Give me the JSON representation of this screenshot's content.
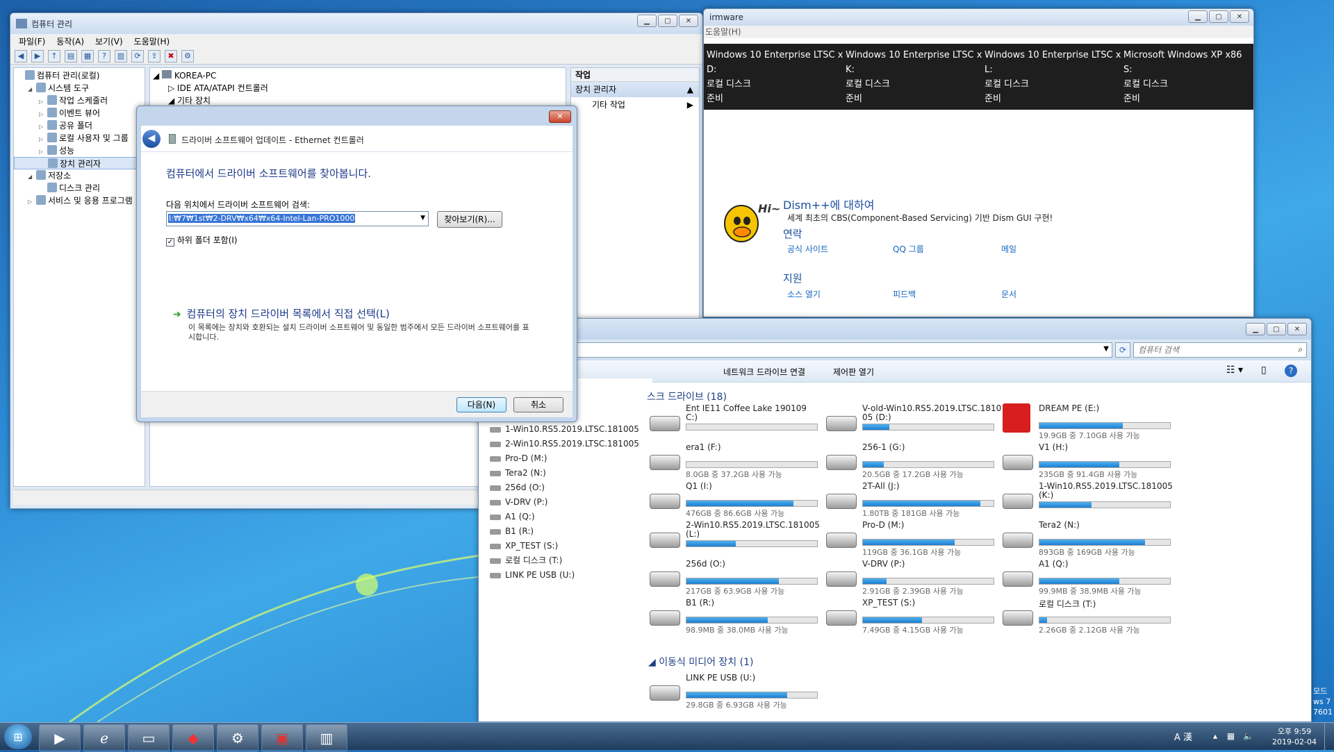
{
  "cm": {
    "title": "컴퓨터 관리",
    "menu": [
      "파일(F)",
      "동작(A)",
      "보기(V)",
      "도움말(H)"
    ],
    "tree": [
      {
        "label": "컴퓨터 관리(로컬)",
        "indent": 0,
        "exp": ""
      },
      {
        "label": "시스템 도구",
        "indent": 1,
        "exp": "◢"
      },
      {
        "label": "작업 스케줄러",
        "indent": 2,
        "exp": "▷"
      },
      {
        "label": "이벤트 뷰어",
        "indent": 2,
        "exp": "▷"
      },
      {
        "label": "공유 폴더",
        "indent": 2,
        "exp": "▷"
      },
      {
        "label": "로컬 사용자 및 그룹",
        "indent": 2,
        "exp": "▷"
      },
      {
        "label": "성능",
        "indent": 2,
        "exp": "▷"
      },
      {
        "label": "장치 관리자",
        "indent": 2,
        "exp": "",
        "sel": true
      },
      {
        "label": "저장소",
        "indent": 1,
        "exp": "◢"
      },
      {
        "label": "디스크 관리",
        "indent": 2,
        "exp": ""
      },
      {
        "label": "서비스 및 응용 프로그램",
        "indent": 1,
        "exp": "▷"
      }
    ],
    "dev": [
      "KOREA-PC",
      "IDE ATA/ATAPI 컨트롤러",
      "기타 장치"
    ],
    "actions_header": "작업",
    "actions_section": "장치 관리자",
    "actions_more": "기타 작업"
  },
  "dlg": {
    "title": "드라이버 소프트웨어 업데이트 - Ethernet 컨트롤러",
    "heading": "컴퓨터에서 드라이버 소프트웨어를 찾아봅니다.",
    "search_label": "다음 위치에서 드라이버 소프트웨어 검색:",
    "path": "I:₩7₩1st₩2-DRV₩x64₩x64-Intel-Lan-PRO1000",
    "browse": "찾아보기(R)...",
    "include_sub": "하위 폴더 포함(I)",
    "choose_title": "컴퓨터의 장치 드라이버 목록에서 직접 선택(L)",
    "choose_desc": "이 목록에는 장치와 호환되는 설치 드라이버 소프트웨어 및 동일한 범주에서 모든 드라이버 소프트웨어를 표시합니다.",
    "next": "다음(N)",
    "cancel": "취소"
  },
  "dism": {
    "title_frag": "irmware",
    "menu_frag": "도움말(H)",
    "cols": [
      {
        "name": "Windows 10 Enterprise LTSC xt",
        "drive": "D:",
        "type": "로컬 디스크",
        "status": "준비"
      },
      {
        "name": "Windows 10 Enterprise LTSC xt",
        "drive": "K:",
        "type": "로컬 디스크",
        "status": "준비"
      },
      {
        "name": "Windows 10 Enterprise LTSC xt",
        "drive": "L:",
        "type": "로컬 디스크",
        "status": "준비"
      },
      {
        "name": "Microsoft Windows XP x86",
        "drive": "S:",
        "type": "로컬 디스크",
        "status": "준비"
      }
    ],
    "about_title": "Dism++에 대하여",
    "about_desc": "세계 최초의 CBS(Component-Based Servicing) 기반 Dism GUI 구현!",
    "contact": "연락",
    "c1": "공식 사이트",
    "c2": "QQ 그룹",
    "c3": "메일",
    "support": "지원",
    "s1": "소스 열기",
    "s2": "피드백",
    "s3": "문서",
    "hi": "Hi~"
  },
  "exp": {
    "search_placeholder": "컴퓨터 검색",
    "cmd1": "네트워크 드라이브 연결",
    "cmd2": "제어판 열기",
    "group1": "스크 드라이브 (18)",
    "group2": "이동식 미디어 장치 (1)",
    "drives": [
      {
        "name": "Ent IE11 Coffee Lake 190109",
        "name2": "C:)",
        "info": "",
        "frac": 0
      },
      {
        "name": "V-old-Win10.RS5.2019.LTSC.1810",
        "name2": "05 (D:)",
        "info": "",
        "frac": 0.2
      },
      {
        "name": "DREAM PE (E:)",
        "info": "19.9GB 중 7.10GB 사용 가능",
        "frac": 0.64
      },
      {
        "name": "era1 (F:)",
        "info": "8.0GB 중 37.2GB 사용 가능",
        "frac": 0
      },
      {
        "name": "256-1 (G:)",
        "info": "20.5GB 중 17.2GB 사용 가능",
        "frac": 0.16
      },
      {
        "name": "V1 (H:)",
        "info": "235GB 중 91.4GB 사용 가능",
        "frac": 0.61
      },
      {
        "name": "Q1 (I:)",
        "info": "476GB 중 86.6GB 사용 가능",
        "frac": 0.82
      },
      {
        "name": "2T-All (J:)",
        "info": "1.80TB 중 181GB 사용 가능",
        "frac": 0.9
      },
      {
        "name": "1-Win10.RS5.2019.LTSC.181005",
        "name2": "(K:)",
        "info": "",
        "frac": 0.4
      },
      {
        "name": "2-Win10.RS5.2019.LTSC.181005",
        "name2": "(L:)",
        "info": "",
        "frac": 0.38
      },
      {
        "name": "Pro-D (M:)",
        "info": "119GB 중 36.1GB 사용 가능",
        "frac": 0.7
      },
      {
        "name": "Tera2 (N:)",
        "info": "893GB 중 169GB 사용 가능",
        "frac": 0.81
      },
      {
        "name": "256d (O:)",
        "info": "217GB 중 63.9GB 사용 가능",
        "frac": 0.71
      },
      {
        "name": "V-DRV (P:)",
        "info": "2.91GB 중 2.39GB 사용 가능",
        "frac": 0.18
      },
      {
        "name": "A1 (Q:)",
        "info": "99.9MB 중 38.9MB 사용 가능",
        "frac": 0.61
      },
      {
        "name": "B1 (R:)",
        "info": "98.9MB 중 38.0MB 사용 가능",
        "frac": 0.62
      },
      {
        "name": "XP_TEST (S:)",
        "info": "7.49GB 중 4.15GB 사용 가능",
        "frac": 0.45
      },
      {
        "name": "로컬 디스크 (T:)",
        "info": "2.26GB 중 2.12GB 사용 가능",
        "frac": 0.06
      },
      {
        "name": "LINK PE USB (U:)",
        "info": "29.8GB 중 6.93GB 사용 가능",
        "frac": 0.77
      }
    ],
    "nav": [
      "V1 (H:)",
      "Q1 (I:)",
      "2T-All (J:)",
      "1-Win10.RS5.2019.LTSC.181005",
      "2-Win10.RS5.2019.LTSC.181005",
      "Pro-D (M:)",
      "Tera2 (N:)",
      "256d (O:)",
      "V-DRV (P:)",
      "A1 (Q:)",
      "B1 (R:)",
      "XP_TEST (S:)",
      "로컬 디스크 (T:)",
      "LINK PE USB (U:)"
    ]
  },
  "taskbar": {
    "time": "오후 9:59",
    "date": "2019-02-04",
    "ime": "A 漢",
    "edge1": "모드",
    "edge2": "ws 7",
    "edge3": "7601"
  }
}
